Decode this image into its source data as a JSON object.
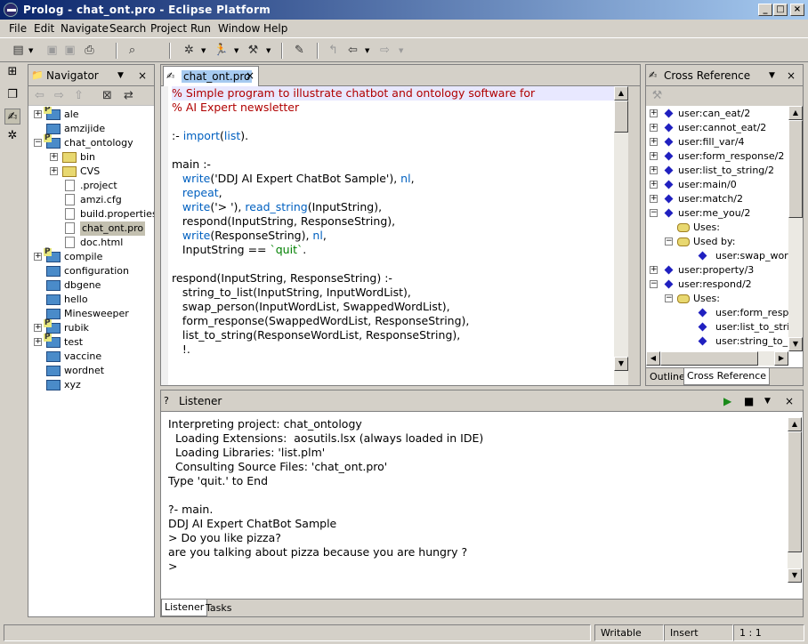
{
  "window": {
    "title": "Prolog - chat_ont.pro - Eclipse Platform",
    "minimize": "_",
    "maximize": "□",
    "close": "×"
  },
  "menu": [
    "File",
    "Edit",
    "Navigate",
    "Search",
    "Project",
    "Run",
    "Window",
    "Help"
  ],
  "navigator": {
    "title": "Navigator",
    "items": [
      {
        "label": "ale",
        "kind": "project",
        "level": 0,
        "expander": "+"
      },
      {
        "label": "amzijide",
        "kind": "folder",
        "level": 0,
        "expander": ""
      },
      {
        "label": "chat_ontology",
        "kind": "project",
        "level": 0,
        "expander": "-"
      },
      {
        "label": "bin",
        "kind": "yellow",
        "level": 1,
        "expander": "+"
      },
      {
        "label": "CVS",
        "kind": "yellow",
        "level": 1,
        "expander": "+"
      },
      {
        "label": ".project",
        "kind": "file",
        "level": 1,
        "expander": ""
      },
      {
        "label": "amzi.cfg",
        "kind": "file",
        "level": 1,
        "expander": ""
      },
      {
        "label": "build.properties",
        "kind": "file",
        "level": 1,
        "expander": ""
      },
      {
        "label": "chat_ont.pro",
        "kind": "file",
        "level": 1,
        "expander": "",
        "selected": true
      },
      {
        "label": "doc.html",
        "kind": "file",
        "level": 1,
        "expander": ""
      },
      {
        "label": "compile",
        "kind": "project",
        "level": 0,
        "expander": "+"
      },
      {
        "label": "configuration",
        "kind": "folder",
        "level": 0,
        "expander": ""
      },
      {
        "label": "dbgene",
        "kind": "folder",
        "level": 0,
        "expander": ""
      },
      {
        "label": "hello",
        "kind": "folder",
        "level": 0,
        "expander": ""
      },
      {
        "label": "Minesweeper",
        "kind": "folder",
        "level": 0,
        "expander": ""
      },
      {
        "label": "rubik",
        "kind": "project",
        "level": 0,
        "expander": "+"
      },
      {
        "label": "test",
        "kind": "project",
        "level": 0,
        "expander": "+"
      },
      {
        "label": "vaccine",
        "kind": "folder",
        "level": 0,
        "expander": ""
      },
      {
        "label": "wordnet",
        "kind": "folder",
        "level": 0,
        "expander": ""
      },
      {
        "label": "xyz",
        "kind": "folder",
        "level": 0,
        "expander": ""
      }
    ]
  },
  "editor": {
    "tab": "chat_ont.pro",
    "lines": [
      [
        {
          "t": "% Simple program to illustrate chatbot and ontology software for",
          "c": "cmt"
        }
      ],
      [
        {
          "t": "% AI Expert newsletter",
          "c": "cmt"
        }
      ],
      [
        {
          "t": ""
        }
      ],
      [
        {
          "t": ":- "
        },
        {
          "t": "import",
          "c": "kw"
        },
        {
          "t": "("
        },
        {
          "t": "list",
          "c": "kw"
        },
        {
          "t": ")."
        }
      ],
      [
        {
          "t": ""
        }
      ],
      [
        {
          "t": "main :-"
        }
      ],
      [
        {
          "t": "   "
        },
        {
          "t": "write",
          "c": "kw"
        },
        {
          "t": "('DDJ AI Expert ChatBot Sample'), "
        },
        {
          "t": "nl",
          "c": "kw"
        },
        {
          "t": ","
        }
      ],
      [
        {
          "t": "   "
        },
        {
          "t": "repeat",
          "c": "kw"
        },
        {
          "t": ","
        }
      ],
      [
        {
          "t": "   "
        },
        {
          "t": "write",
          "c": "kw"
        },
        {
          "t": "('> '), "
        },
        {
          "t": "read_string",
          "c": "kw"
        },
        {
          "t": "(InputString),"
        }
      ],
      [
        {
          "t": "   respond(InputString, ResponseString),"
        }
      ],
      [
        {
          "t": "   "
        },
        {
          "t": "write",
          "c": "kw"
        },
        {
          "t": "(ResponseString), "
        },
        {
          "t": "nl",
          "c": "kw"
        },
        {
          "t": ","
        }
      ],
      [
        {
          "t": "   InputString == "
        },
        {
          "t": "`quit`",
          "c": "str"
        },
        {
          "t": "."
        }
      ],
      [
        {
          "t": ""
        }
      ],
      [
        {
          "t": "respond(InputString, ResponseString) :-"
        }
      ],
      [
        {
          "t": "   string_to_list(InputString, InputWordList),"
        }
      ],
      [
        {
          "t": "   swap_person(InputWordList, SwappedWordList),"
        }
      ],
      [
        {
          "t": "   form_response(SwappedWordList, ResponseString),"
        }
      ],
      [
        {
          "t": "   list_to_string(ResponseWordList, ResponseString),"
        }
      ],
      [
        {
          "t": "   !."
        }
      ]
    ]
  },
  "crossref": {
    "title": "Cross Reference",
    "items": [
      {
        "label": "user:can_eat/2",
        "kind": "pred",
        "level": 0,
        "expander": "+"
      },
      {
        "label": "user:cannot_eat/2",
        "kind": "pred",
        "level": 0,
        "expander": "+"
      },
      {
        "label": "user:fill_var/4",
        "kind": "pred",
        "level": 0,
        "expander": "+"
      },
      {
        "label": "user:form_response/2",
        "kind": "pred",
        "level": 0,
        "expander": "+"
      },
      {
        "label": "user:list_to_string/2",
        "kind": "pred",
        "level": 0,
        "expander": "+"
      },
      {
        "label": "user:main/0",
        "kind": "pred",
        "level": 0,
        "expander": "+"
      },
      {
        "label": "user:match/2",
        "kind": "pred",
        "level": 0,
        "expander": "+"
      },
      {
        "label": "user:me_you/2",
        "kind": "pred",
        "level": 0,
        "expander": "-"
      },
      {
        "label": "Uses:",
        "kind": "link",
        "level": 1,
        "expander": ""
      },
      {
        "label": "Used by:",
        "kind": "link",
        "level": 1,
        "expander": "-"
      },
      {
        "label": "user:swap_word/",
        "kind": "dia",
        "level": 2,
        "expander": ""
      },
      {
        "label": "user:property/3",
        "kind": "pred",
        "level": 0,
        "expander": "+"
      },
      {
        "label": "user:respond/2",
        "kind": "pred",
        "level": 0,
        "expander": "-"
      },
      {
        "label": "Uses:",
        "kind": "link",
        "level": 1,
        "expander": "-"
      },
      {
        "label": "user:form_respon",
        "kind": "dia",
        "level": 2,
        "expander": ""
      },
      {
        "label": "user:list_to_string",
        "kind": "dia",
        "level": 2,
        "expander": ""
      },
      {
        "label": "user:string_to_list",
        "kind": "dia",
        "level": 2,
        "expander": ""
      }
    ],
    "tabs": [
      "Outline",
      "Cross Reference"
    ]
  },
  "listener": {
    "title": "Listener",
    "text": "Interpreting project: chat_ontology\n  Loading Extensions:  aosutils.lsx (always loaded in IDE)\n  Loading Libraries: 'list.plm'\n  Consulting Source Files: 'chat_ont.pro'\nType 'quit.' to End\n\n?- main.\nDDJ AI Expert ChatBot Sample\n> Do you like pizza?\nare you talking about pizza because you are hungry ?\n>",
    "tabs": [
      "Listener",
      "Tasks"
    ]
  },
  "status": {
    "mode": "Writable",
    "insert": "Insert",
    "position": "1 : 1"
  }
}
